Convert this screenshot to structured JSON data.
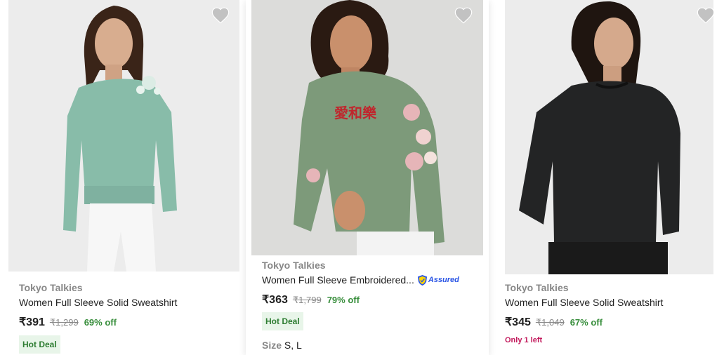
{
  "products": [
    {
      "brand": "Tokyo Talkies",
      "title": "Women Full Sleeve Solid Sweatshirt",
      "price": "₹391",
      "mrp": "₹1,299",
      "discount": "69% off",
      "badge": "Hot Deal",
      "sweater_color": "#88bca9",
      "icon": "heart-icon"
    },
    {
      "brand": "Tokyo Talkies",
      "title": "Women Full Sleeve Embroidered...",
      "assured": "Assured",
      "price": "₹363",
      "mrp": "₹1,799",
      "discount": "79% off",
      "badge": "Hot Deal",
      "size_label": "Size",
      "sizes": "S, L",
      "sweater_color": "#7d9a7a",
      "icon": "heart-icon"
    },
    {
      "brand": "Tokyo Talkies",
      "title": "Women Full Sleeve Solid Sweatshirt",
      "price": "₹345",
      "mrp": "₹1,049",
      "discount": "67% off",
      "stock_note": "Only 1 left",
      "sweater_color": "#232425",
      "icon": "heart-icon"
    }
  ],
  "colors": {
    "discount_green": "#388e3c",
    "badge_bg": "#e8f5e9",
    "stock_pink": "#c2185b",
    "muted_text": "#878787",
    "wishlist_grey": "#c2c2c2"
  }
}
